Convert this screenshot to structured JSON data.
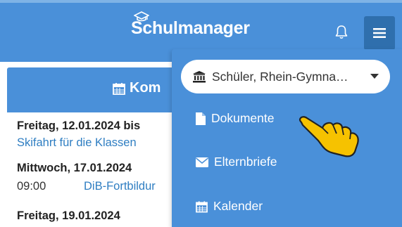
{
  "header": {
    "app_title": "Schulmanager"
  },
  "card": {
    "title": "Kom"
  },
  "events": {
    "e1_date": "Freitag, 12.01.2024 bis",
    "e1_link": "Skifahrt für die Klassen",
    "e2_date": "Mittwoch, 17.01.2024",
    "e2_time": "09:00",
    "e2_link": "DiB-Fortbildur",
    "e3_date": "Freitag, 19.01.2024"
  },
  "menu": {
    "school_selector": "Schüler, Rhein-Gymna…",
    "items": [
      {
        "label": "Dokumente",
        "icon": "file-icon"
      },
      {
        "label": "Elternbriefe",
        "icon": "envelope-icon"
      },
      {
        "label": "Kalender",
        "icon": "calendar-icon"
      }
    ]
  },
  "colors": {
    "primary": "#4a90d9",
    "primary_dark": "#2f6fad",
    "link": "#2f7ec2",
    "pointer": "#f6c200"
  }
}
